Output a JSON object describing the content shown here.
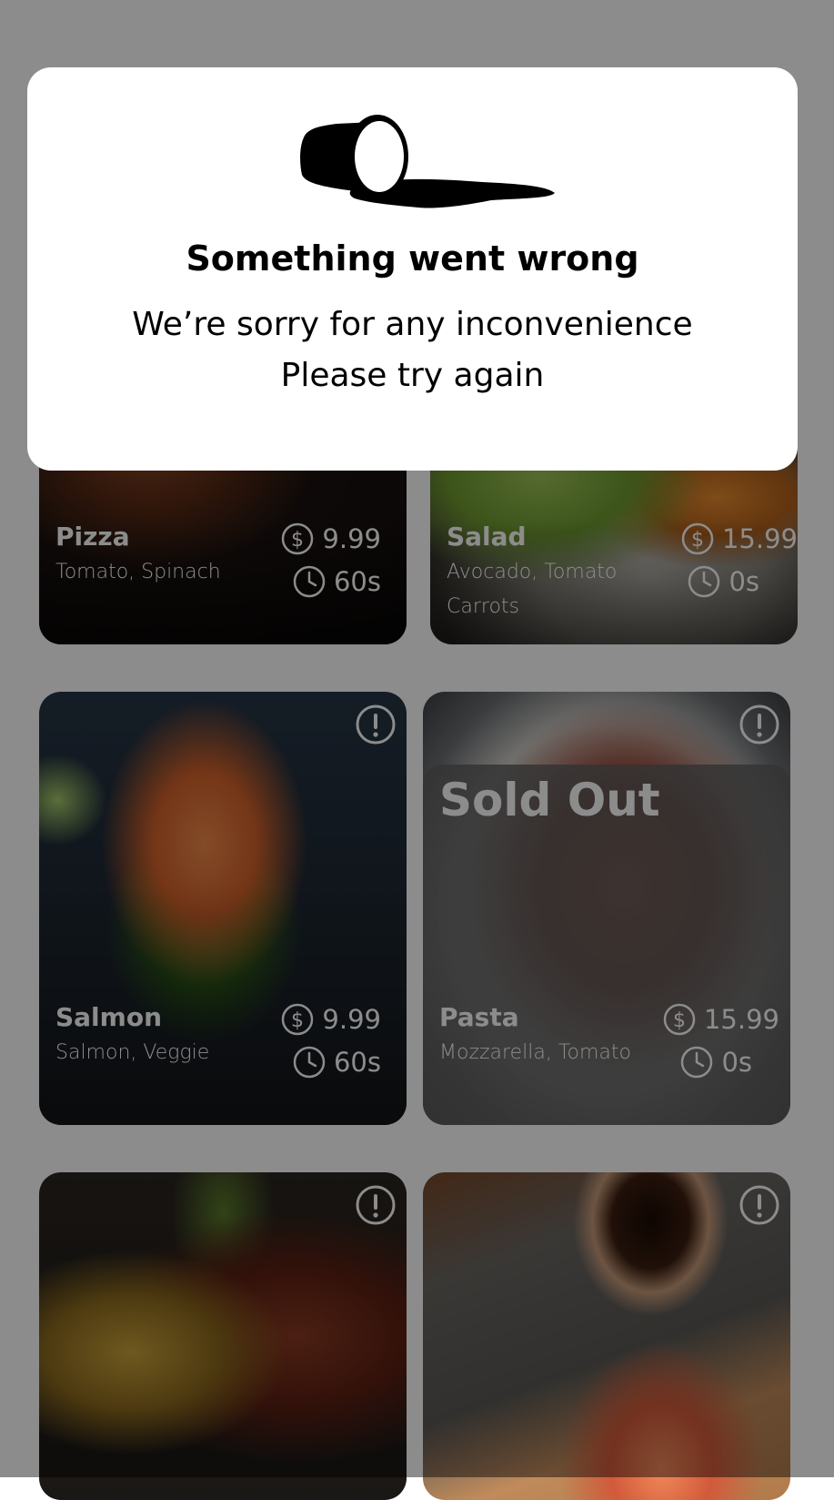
{
  "dialog": {
    "title": "Something went wrong",
    "message_line1": "We’re sorry for any inconvenience",
    "message_line2": "Please try again",
    "illustration_icon": "spilled-cup-icon"
  },
  "menu": {
    "sold_out_label": "Sold Out",
    "items": [
      {
        "name": "Pizza",
        "ingredients": "Tomato, Spinach",
        "price": "9.99",
        "time": "60s",
        "sold_out": false
      },
      {
        "name": "Salad",
        "ingredients": "Avocado, Tomato Carrots",
        "price": "15.99",
        "time": "0s",
        "sold_out": false
      },
      {
        "name": "Salmon",
        "ingredients": "Salmon, Veggie",
        "price": "9.99",
        "time": "60s",
        "sold_out": false
      },
      {
        "name": "Pasta",
        "ingredients": "Mozzarella, Tomato",
        "price": "15.99",
        "time": "0s",
        "sold_out": true
      },
      {
        "name": "",
        "ingredients": "",
        "price": "",
        "time": "",
        "sold_out": false
      },
      {
        "name": "",
        "ingredients": "",
        "price": "",
        "time": "",
        "sold_out": false
      }
    ],
    "icons": {
      "info": "info-icon",
      "price": "dollar-circle-icon",
      "time": "clock-icon"
    }
  },
  "colors": {
    "overlay": "#000000",
    "dialog_bg": "#ffffff",
    "text_on_card": "#ffffff"
  }
}
